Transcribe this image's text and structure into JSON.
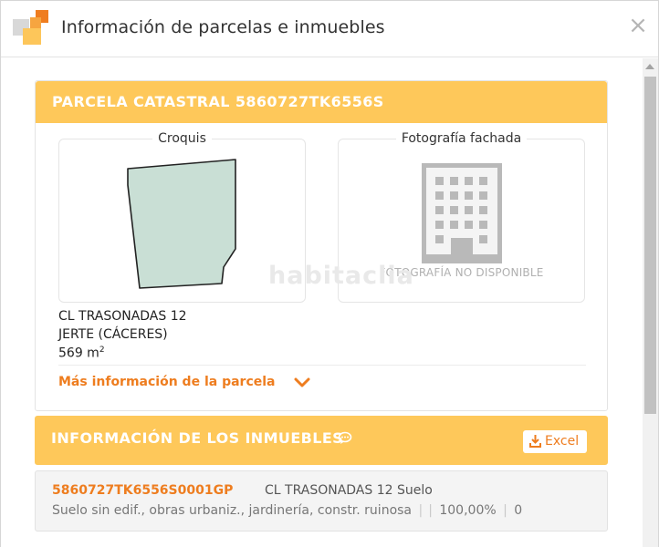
{
  "dialog": {
    "title": "Información de parcelas e inmuebles",
    "close_symbol": "×"
  },
  "parcel": {
    "header": "PARCELA CATASTRAL 5860727TK6556S",
    "croquis_title": "Croquis",
    "foto_title": "Fotografía fachada",
    "no_photo": "FOTOGRAFÍA NO DISPONIBLE",
    "watermark": "habitaclia",
    "address_line1": "CL TRASONADAS 12",
    "address_line2": "JERTE (CÁCERES)",
    "area_value": "569 m",
    "area_sup": "2",
    "more_info": "Más información de la parcela"
  },
  "inmuebles": {
    "header": "INFORMACIÓN DE LOS INMUEBLES",
    "excel_label": "Excel",
    "row": {
      "ref": "5860727TK6556S0001GP",
      "address": "CL TRASONADAS 12 Suelo",
      "use": "Suelo sin edif., obras urbaniz., jardinería, constr. ruinosa",
      "pipe1": "|",
      "pipe2": "|",
      "pipe3": "|",
      "percent": "100,00%",
      "count": "0"
    }
  },
  "colors": {
    "accent": "#ee7d1f",
    "header_yellow": "#fec85a",
    "sketch_fill": "#c9dfd5"
  },
  "icons": {
    "logo": "orange-squares-logo-icon",
    "close": "close-icon",
    "building": "building-icon",
    "chevron": "chevron-down-icon",
    "comment": "comment-icon",
    "download": "download-icon"
  }
}
